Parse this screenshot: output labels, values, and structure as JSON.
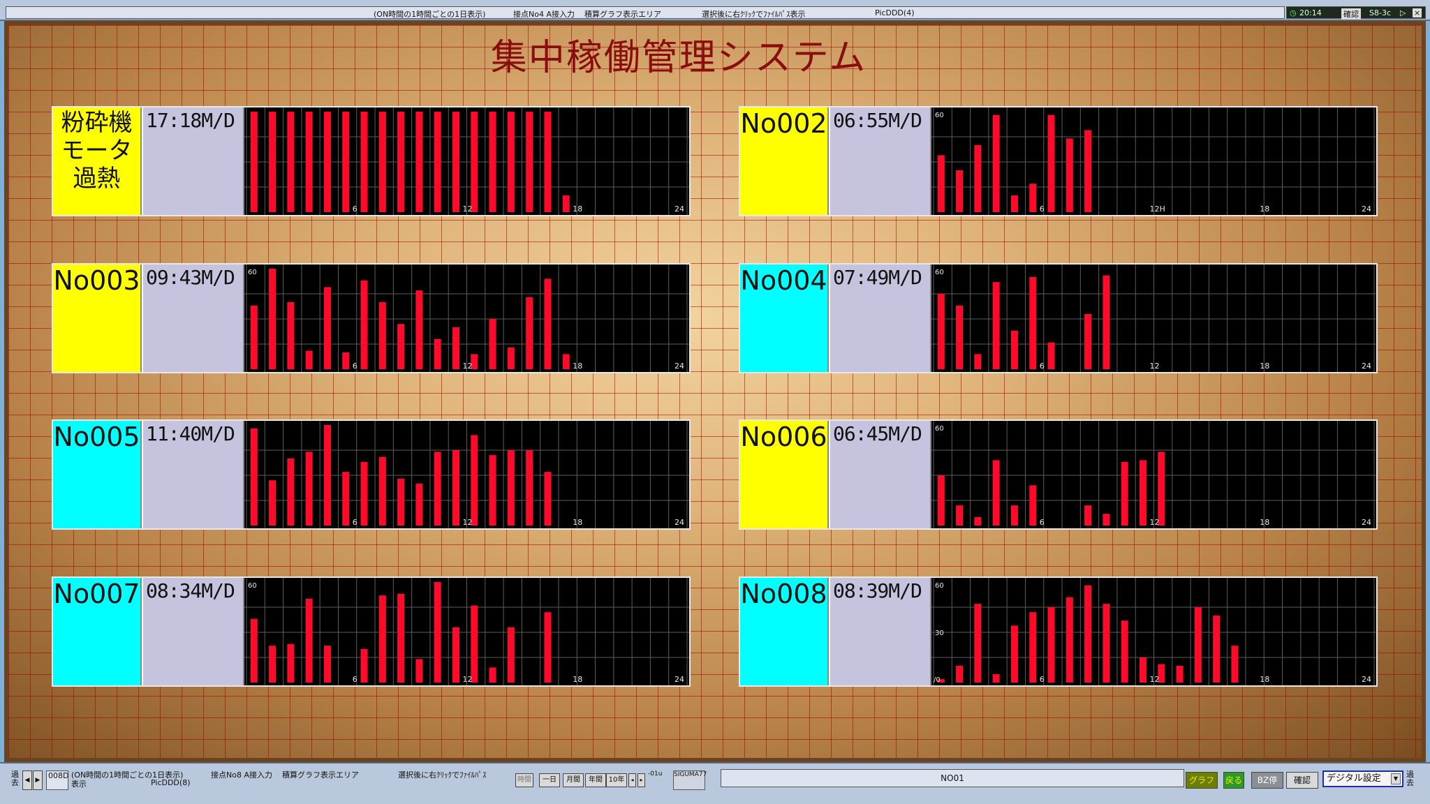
{
  "top_bar": {
    "mode_text": "(ON時間の1時間ごとの1日表示)",
    "input_text": "接点No4 A接入力",
    "area_text": "積算グラフ表示エリア",
    "hint_text": "選択後に右ｸﾘｯｸでﾌｧｲﾙﾊﾟｽ表示",
    "pic_text": "PicDDD(4)",
    "clock": "20:14",
    "confirm_label": "確認",
    "code_label": "S8-3c"
  },
  "app": {
    "title": "集中稼働管理システム"
  },
  "panels": [
    {
      "name": "粉砕機モータ過熱",
      "name_lines": [
        "粉砕機",
        "モータ",
        "過熱"
      ],
      "time": "17:18M/D",
      "color": "#ffff00",
      "y_max_label": "",
      "y_mid_label": "",
      "x_labels": [
        "6",
        "12",
        "18",
        "24"
      ],
      "values": [
        60,
        60,
        60,
        60,
        60,
        60,
        60,
        60,
        60,
        60,
        60,
        60,
        60,
        60,
        60,
        60,
        60,
        10,
        0,
        0,
        0,
        0,
        0,
        0
      ]
    },
    {
      "name": "No002",
      "name_lines": [
        "No002"
      ],
      "time": "06:55M/D",
      "color": "#ffff00",
      "y_max_label": "60",
      "y_mid_label": "",
      "x_labels": [
        "6",
        "12H",
        "18",
        "24"
      ],
      "values": [
        34,
        25,
        40,
        58,
        10,
        17,
        58,
        44,
        49,
        0,
        0,
        0,
        0,
        0,
        0,
        0,
        0,
        0,
        0,
        0,
        0,
        0,
        0,
        0,
        0
      ],
      "values_hours": [
        34,
        25,
        40,
        58,
        10,
        17,
        58,
        44,
        49,
        0,
        0,
        0,
        0,
        0,
        0,
        0,
        0,
        0,
        0,
        0,
        0,
        0,
        0,
        0
      ]
    },
    {
      "name": "No003",
      "name_lines": [
        "No003"
      ],
      "time": "09:43M/D",
      "color": "#ffff00",
      "y_max_label": "60",
      "y_mid_label": "",
      "x_labels": [
        "6",
        "12",
        "18",
        "24"
      ],
      "values": [
        38,
        60,
        40,
        11,
        49,
        10,
        53,
        40,
        27,
        47,
        18,
        25,
        9,
        30,
        13,
        43,
        54,
        9,
        0,
        0,
        0,
        0,
        0,
        0
      ]
    },
    {
      "name": "No004",
      "name_lines": [
        "No004"
      ],
      "time": "07:49M/D",
      "color": "#00ffff",
      "y_max_label": "60",
      "y_mid_label": "",
      "x_labels": [
        "6",
        "12",
        "18",
        "24"
      ],
      "values": [
        45,
        38,
        9,
        52,
        23,
        55,
        16,
        0,
        33,
        56,
        0,
        0,
        0,
        0,
        0,
        0,
        0,
        0,
        0,
        0,
        0,
        0,
        0,
        0
      ]
    },
    {
      "name": "No005",
      "name_lines": [
        "No005"
      ],
      "time": "11:40M/D",
      "color": "#00ffff",
      "y_max_label": "",
      "y_mid_label": "",
      "x_labels": [
        "6",
        "12",
        "18",
        "24"
      ],
      "values": [
        58,
        27,
        40,
        44,
        60,
        32,
        38,
        41,
        28,
        25,
        44,
        45,
        54,
        42,
        45,
        45,
        32,
        0,
        0,
        0,
        0,
        0,
        0,
        0
      ]
    },
    {
      "name": "No006",
      "name_lines": [
        "No006"
      ],
      "time": "06:45M/D",
      "color": "#ffff00",
      "y_max_label": "60",
      "y_mid_label": "",
      "x_labels": [
        "6",
        "12",
        "18",
        "24"
      ],
      "values": [
        30,
        12,
        5,
        39,
        12,
        24,
        0,
        0,
        12,
        7,
        38,
        39,
        44,
        0,
        0,
        0,
        0,
        0,
        0,
        0,
        0,
        0,
        0,
        0
      ]
    },
    {
      "name": "No007",
      "name_lines": [
        "No007"
      ],
      "time": "08:34M/D",
      "color": "#00ffff",
      "y_max_label": "60",
      "y_mid_label": "",
      "x_labels": [
        "6",
        "12",
        "18",
        "24"
      ],
      "values": [
        38,
        22,
        23,
        50,
        22,
        0,
        20,
        52,
        53,
        14,
        60,
        33,
        46,
        9,
        33,
        0,
        42,
        0,
        0,
        0,
        0,
        0,
        0,
        0
      ]
    },
    {
      "name": "No008",
      "name_lines": [
        "No008"
      ],
      "time": "08:39M/D",
      "color": "#00ffff",
      "y_max_label": "60",
      "y_mid_label": "30",
      "y_min_label": "/0",
      "x_labels": [
        "6",
        "12",
        "18",
        "24"
      ],
      "values": [
        2,
        10,
        47,
        5,
        34,
        42,
        45,
        51,
        58,
        47,
        37,
        15,
        11,
        10,
        45,
        40,
        22,
        0,
        0,
        0,
        0,
        0,
        0,
        0
      ]
    }
  ],
  "chart_data": [
    {
      "type": "bar",
      "title": "粉砕機モータ過熱",
      "x": [
        "1",
        "2",
        "3",
        "4",
        "5",
        "6",
        "7",
        "8",
        "9",
        "10",
        "11",
        "12",
        "13",
        "14",
        "15",
        "16",
        "17",
        "18",
        "19",
        "20",
        "21",
        "22",
        "23",
        "24"
      ],
      "values": [
        60,
        60,
        60,
        60,
        60,
        60,
        60,
        60,
        60,
        60,
        60,
        60,
        60,
        60,
        60,
        60,
        60,
        10,
        0,
        0,
        0,
        0,
        0,
        0
      ],
      "ylim": [
        0,
        60
      ],
      "xticks": [
        "6",
        "12",
        "18",
        "24"
      ]
    },
    {
      "type": "bar",
      "title": "No002",
      "x": [
        "1",
        "2",
        "3",
        "4",
        "5",
        "6",
        "7",
        "8",
        "9",
        "10",
        "11",
        "12",
        "13",
        "14",
        "15",
        "16",
        "17",
        "18",
        "19",
        "20",
        "21",
        "22",
        "23",
        "24"
      ],
      "values": [
        34,
        25,
        40,
        58,
        10,
        17,
        58,
        44,
        49,
        0,
        0,
        0,
        0,
        0,
        0,
        0,
        0,
        0,
        0,
        0,
        0,
        0,
        0,
        0
      ],
      "ylim": [
        0,
        60
      ],
      "xticks": [
        "6",
        "12H",
        "18",
        "24"
      ]
    },
    {
      "type": "bar",
      "title": "No003",
      "x": [
        "1",
        "2",
        "3",
        "4",
        "5",
        "6",
        "7",
        "8",
        "9",
        "10",
        "11",
        "12",
        "13",
        "14",
        "15",
        "16",
        "17",
        "18",
        "19",
        "20",
        "21",
        "22",
        "23",
        "24"
      ],
      "values": [
        38,
        60,
        40,
        11,
        49,
        10,
        53,
        40,
        27,
        47,
        18,
        25,
        9,
        30,
        13,
        43,
        54,
        9,
        0,
        0,
        0,
        0,
        0,
        0
      ],
      "ylim": [
        0,
        60
      ],
      "xticks": [
        "6",
        "12",
        "18",
        "24"
      ]
    },
    {
      "type": "bar",
      "title": "No004",
      "x": [
        "1",
        "2",
        "3",
        "4",
        "5",
        "6",
        "7",
        "8",
        "9",
        "10",
        "11",
        "12",
        "13",
        "14",
        "15",
        "16",
        "17",
        "18",
        "19",
        "20",
        "21",
        "22",
        "23",
        "24"
      ],
      "values": [
        45,
        38,
        9,
        52,
        23,
        55,
        16,
        0,
        33,
        56,
        0,
        0,
        0,
        0,
        0,
        0,
        0,
        0,
        0,
        0,
        0,
        0,
        0,
        0
      ],
      "ylim": [
        0,
        60
      ],
      "xticks": [
        "6",
        "12",
        "18",
        "24"
      ]
    },
    {
      "type": "bar",
      "title": "No005",
      "x": [
        "1",
        "2",
        "3",
        "4",
        "5",
        "6",
        "7",
        "8",
        "9",
        "10",
        "11",
        "12",
        "13",
        "14",
        "15",
        "16",
        "17",
        "18",
        "19",
        "20",
        "21",
        "22",
        "23",
        "24"
      ],
      "values": [
        58,
        27,
        40,
        44,
        60,
        32,
        38,
        41,
        28,
        25,
        44,
        45,
        54,
        42,
        45,
        45,
        32,
        0,
        0,
        0,
        0,
        0,
        0,
        0
      ],
      "ylim": [
        0,
        60
      ],
      "xticks": [
        "6",
        "12",
        "18",
        "24"
      ]
    },
    {
      "type": "bar",
      "title": "No006",
      "x": [
        "1",
        "2",
        "3",
        "4",
        "5",
        "6",
        "7",
        "8",
        "9",
        "10",
        "11",
        "12",
        "13",
        "14",
        "15",
        "16",
        "17",
        "18",
        "19",
        "20",
        "21",
        "22",
        "23",
        "24"
      ],
      "values": [
        30,
        12,
        5,
        39,
        12,
        24,
        0,
        0,
        12,
        7,
        38,
        39,
        44,
        0,
        0,
        0,
        0,
        0,
        0,
        0,
        0,
        0,
        0,
        0
      ],
      "ylim": [
        0,
        60
      ],
      "xticks": [
        "6",
        "12",
        "18",
        "24"
      ]
    },
    {
      "type": "bar",
      "title": "No007",
      "x": [
        "1",
        "2",
        "3",
        "4",
        "5",
        "6",
        "7",
        "8",
        "9",
        "10",
        "11",
        "12",
        "13",
        "14",
        "15",
        "16",
        "17",
        "18",
        "19",
        "20",
        "21",
        "22",
        "23",
        "24"
      ],
      "values": [
        38,
        22,
        23,
        50,
        22,
        0,
        20,
        52,
        53,
        14,
        60,
        33,
        46,
        9,
        33,
        0,
        42,
        0,
        0,
        0,
        0,
        0,
        0,
        0
      ],
      "ylim": [
        0,
        60
      ],
      "xticks": [
        "6",
        "12",
        "18",
        "24"
      ]
    },
    {
      "type": "bar",
      "title": "No008",
      "x": [
        "1",
        "2",
        "3",
        "4",
        "5",
        "6",
        "7",
        "8",
        "9",
        "10",
        "11",
        "12",
        "13",
        "14",
        "15",
        "16",
        "17",
        "18",
        "19",
        "20",
        "21",
        "22",
        "23",
        "24"
      ],
      "values": [
        2,
        10,
        47,
        5,
        34,
        42,
        45,
        51,
        58,
        47,
        37,
        15,
        11,
        10,
        45,
        40,
        22,
        0,
        0,
        0,
        0,
        0,
        0,
        0
      ],
      "ylim": [
        0,
        60
      ],
      "xticks": [
        "6",
        "12",
        "18",
        "24"
      ]
    }
  ],
  "bottom_bar": {
    "past_label": "過去",
    "prev_glyph": "◀",
    "next_glyph": "▶",
    "device_code": "008D",
    "mode_text": "(ON時間の1時間ごとの1日表示)",
    "display_label": "表示",
    "pic_text": "PicDDD(8)",
    "input_text": "接点No8 A接入力",
    "area_text": "積算グラフ表示エリア",
    "hint_text": "選択後に右ｸﾘｯｸでﾌｧｲﾙﾊﾟｽ",
    "hourly_label": "時間",
    "day_label": "一日",
    "month_label": "月間",
    "year_label": "年間",
    "decade_label": "10年",
    "step_label": "-01u",
    "sigma_label": "SIGUMA77",
    "device_name": "NO01",
    "graph_button": "グラフ",
    "back_button": "戻る",
    "bz_button": "BZ停",
    "confirm_button": "確認",
    "digital_settings": "デジタル設定",
    "right_label": "過去"
  }
}
